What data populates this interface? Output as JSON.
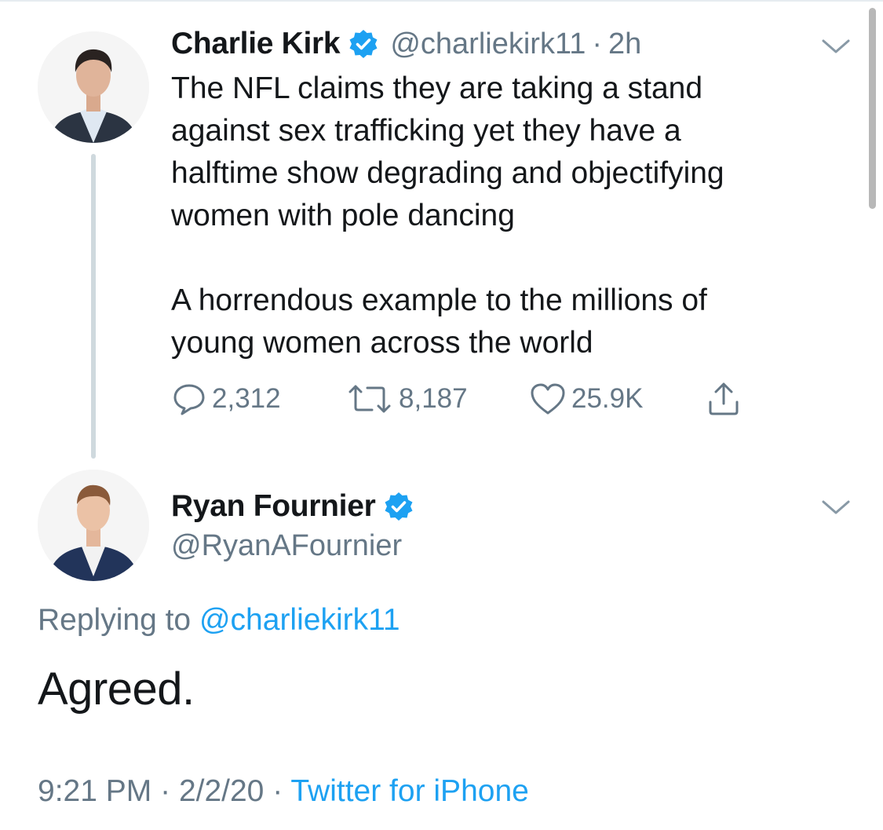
{
  "colors": {
    "accent": "#1da1f2",
    "secondary_text": "#657786",
    "primary_text": "#14171a",
    "thread_line": "#cfd9de"
  },
  "tweet": {
    "author_name": "Charlie Kirk",
    "author_handle": "@charliekirk11",
    "separator": "·",
    "time": "2h",
    "verified_icon": "verified-badge-icon",
    "text_lines": [
      "The NFL claims they are taking a stand",
      "against sex trafficking yet they have a",
      "halftime show degrading and objectifying",
      "women with pole dancing"
    ],
    "text_lines_2": [
      "A horrendous example to the millions of",
      "young women across the world"
    ],
    "actions": {
      "reply_count": "2,312",
      "retweet_count": "8,187",
      "like_count": "25.9K",
      "reply_icon": "reply-icon",
      "retweet_icon": "retweet-icon",
      "like_icon": "heart-icon",
      "share_icon": "share-icon"
    }
  },
  "reply": {
    "author_name": "Ryan Fournier",
    "author_handle": "@RyanAFournier",
    "replying_prefix": "Replying to",
    "replying_mention": "@charliekirk11",
    "text": "Agreed.",
    "time": "9:21 PM",
    "separator": "·",
    "date": "2/2/20",
    "separator_2": "·",
    "source": "Twitter for iPhone"
  }
}
